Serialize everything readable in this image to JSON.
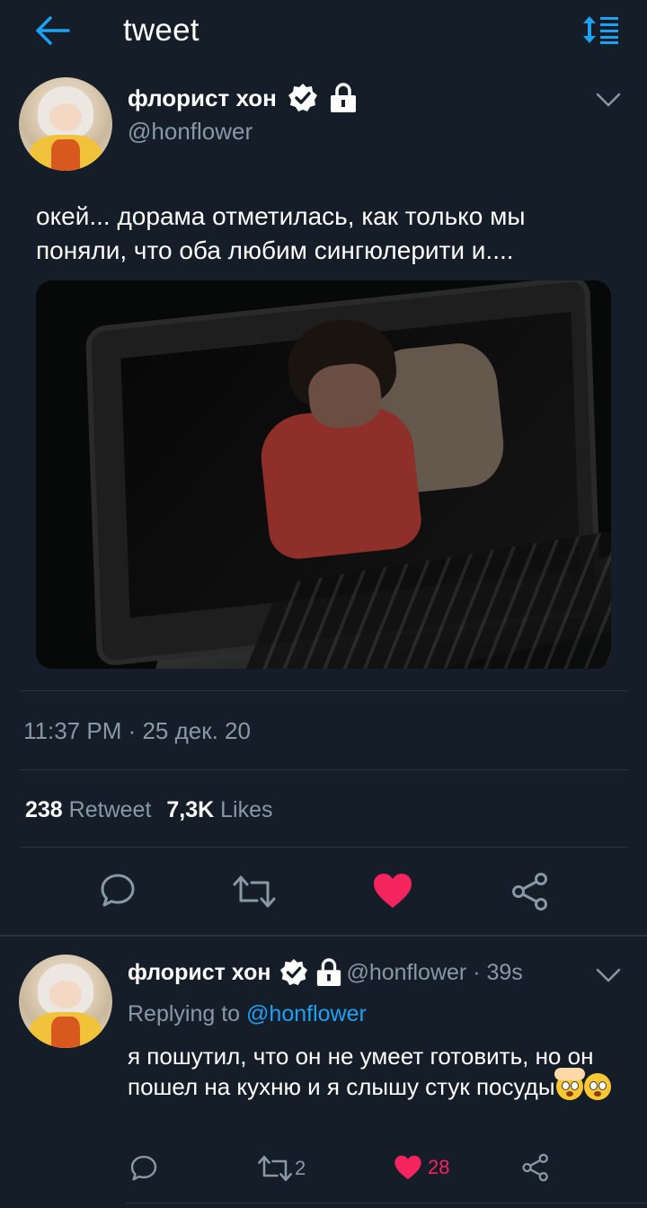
{
  "header": {
    "title": "tweet",
    "back_icon": "arrow-left-icon",
    "sort_icon": "sort-list-icon",
    "accent": "#1da1f2"
  },
  "tweet": {
    "author_name": "флорист хон",
    "handle": "@honflower",
    "verified_icon": "verified-badge-icon",
    "protected_icon": "lock-icon",
    "menu_icon": "chevron-down-icon",
    "text": "окей... дорама отметилась, как только мы поняли, что оба любим сингюлерити и....",
    "media_alt": "laptop-screen-photo",
    "timestamp": "11:37 PM · 25 дек. 20",
    "retweet_count": "238",
    "retweet_label": "Retweet",
    "likes_count": "7,3K",
    "likes_label": "Likes",
    "actions": {
      "reply_icon": "reply-icon",
      "retweet_icon": "retweet-icon",
      "like_icon": "heart-icon",
      "share_icon": "share-icon",
      "like_color": "#f4245e"
    }
  },
  "reply": {
    "author_name": "флорист хон",
    "handle_time": "@honflower · 39s",
    "replying_prefix": "Replying to",
    "replying_handle": "@honflower",
    "text": "я пошутил, что он не умеет готовить, но он пошел на кухню и я слышу стук посуды",
    "emojis": [
      "exploding-head-emoji",
      "flushed-face-emoji"
    ],
    "retweet_count": "2",
    "like_count": "28"
  }
}
